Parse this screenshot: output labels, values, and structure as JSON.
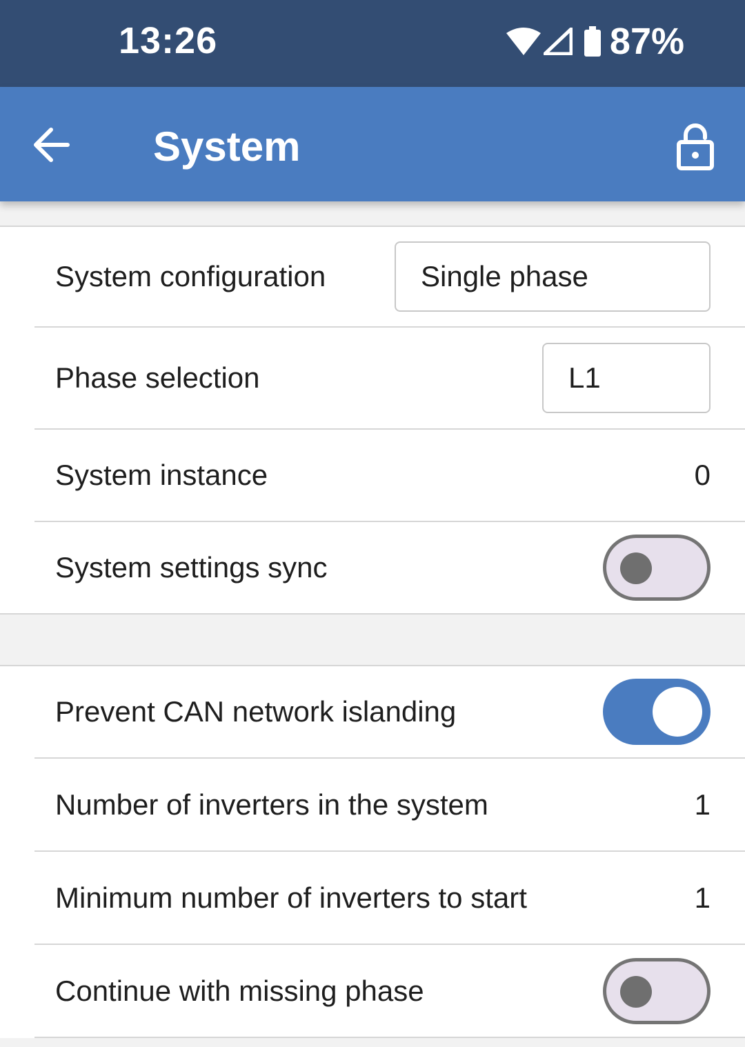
{
  "status_bar": {
    "time": "13:26",
    "battery_percent": "87%",
    "icons": [
      "wifi-icon",
      "cellular-signal-icon",
      "battery-icon"
    ]
  },
  "app_bar": {
    "title": "System",
    "back_icon": "arrow-left-icon",
    "lock_icon": "lock-icon"
  },
  "section1": {
    "system_configuration": {
      "label": "System configuration",
      "value": "Single phase"
    },
    "phase_selection": {
      "label": "Phase selection",
      "value": "L1"
    },
    "system_instance": {
      "label": "System instance",
      "value": "0"
    },
    "settings_sync": {
      "label": "System settings sync",
      "enabled": false
    }
  },
  "section2": {
    "prevent_islanding": {
      "label": "Prevent CAN network islanding",
      "enabled": true
    },
    "num_inverters": {
      "label": "Number of inverters in the system",
      "value": "1"
    },
    "min_inverters": {
      "label": "Minimum number of inverters to start",
      "value": "1"
    },
    "missing_phase": {
      "label": "Continue with missing phase",
      "enabled": false
    }
  },
  "colors": {
    "status_bar": "#334d73",
    "app_bar": "#4a7cc0",
    "toggle_on": "#4a7cc0",
    "toggle_off_track": "#e7e0ec",
    "background": "#f2f2f2"
  }
}
